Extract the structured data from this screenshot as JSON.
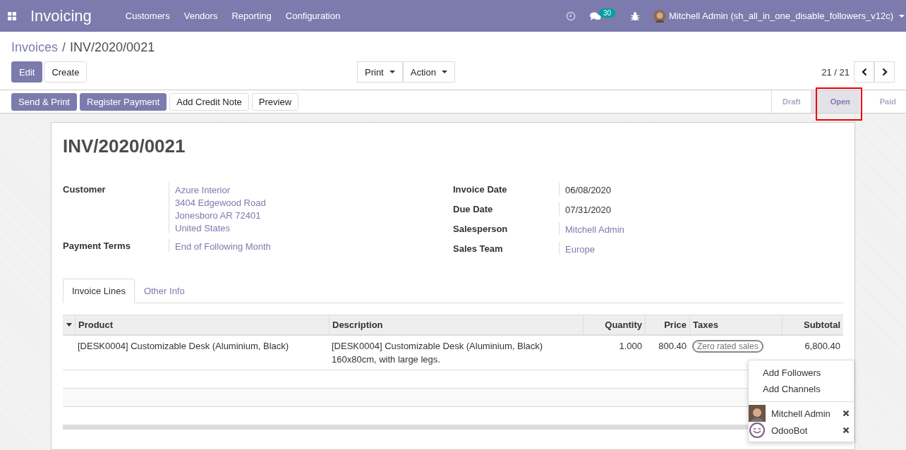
{
  "navbar": {
    "app_name": "Invoicing",
    "menus": [
      "Customers",
      "Vendors",
      "Reporting",
      "Configuration"
    ],
    "message_count": "30",
    "user": "Mitchell Admin (sh_all_in_one_disable_followers_v12c)"
  },
  "breadcrumb": {
    "parent": "Invoices",
    "separator": "/",
    "current": "INV/2020/0021"
  },
  "buttons": [
    {
      "label": "Edit",
      "kind": "primary"
    },
    {
      "label": "Create",
      "kind": "secondary"
    }
  ],
  "menus": [
    "Print",
    "Action"
  ],
  "pager": {
    "text": "21 / 21"
  },
  "status_buttons": [
    {
      "label": "Send & Print",
      "kind": "primary"
    },
    {
      "label": "Register Payment",
      "kind": "primary"
    },
    {
      "label": "Add Credit Note",
      "kind": "secondary"
    },
    {
      "label": "Preview",
      "kind": "secondary"
    }
  ],
  "stages": [
    {
      "label": "Draft",
      "selected": false,
      "highlighted": false
    },
    {
      "label": "Open",
      "selected": true,
      "highlighted": true
    },
    {
      "label": "Paid",
      "selected": false,
      "highlighted": false
    }
  ],
  "title": "INV/2020/0021",
  "left_fields": [
    {
      "label": "Customer",
      "lines": [
        "Azure Interior",
        "3404 Edgewood Road",
        "Jonesboro AR 72401",
        "United States"
      ]
    },
    {
      "label": "Payment Terms",
      "lines": [
        "End of Following Month"
      ]
    }
  ],
  "right_fields": [
    {
      "label": "Invoice Date",
      "value": "06/08/2020",
      "kind": "plain"
    },
    {
      "label": "Due Date",
      "value": "07/31/2020",
      "kind": "plain"
    },
    {
      "label": "Salesperson",
      "value": "Mitchell Admin",
      "kind": "link"
    },
    {
      "label": "Sales Team",
      "value": "Europe",
      "kind": "link"
    }
  ],
  "tabs": [
    {
      "label": "Invoice Lines",
      "selected": true
    },
    {
      "label": "Other Info",
      "selected": false
    }
  ],
  "table": {
    "columns": [
      "Product",
      "Description",
      "Quantity",
      "Price",
      "Taxes",
      "Subtotal"
    ],
    "rows": [
      {
        "product": "[DESK0004] Customizable Desk (Aluminium, Black)",
        "description": "[DESK0004] Customizable Desk (Aluminium, Black)\n160x80cm, with large legs.",
        "quantity": "1.000",
        "price": "800.40",
        "tax": "Zero rated sales",
        "subtotal": "6,800.40"
      }
    ]
  },
  "followers_menu": {
    "actions": [
      "Add Followers",
      "Add Channels"
    ],
    "followers": [
      {
        "name": "Mitchell Admin",
        "kind": "photo"
      },
      {
        "name": "OdooBot",
        "kind": "bot"
      }
    ]
  }
}
